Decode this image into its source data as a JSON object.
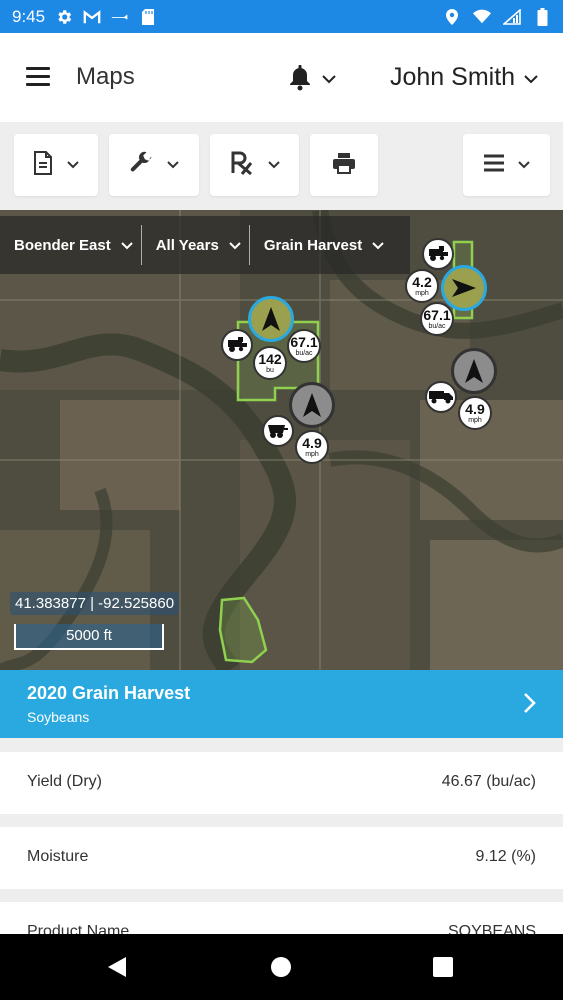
{
  "status_bar": {
    "time": "9:45"
  },
  "app_bar": {
    "title": "Maps",
    "user_name": "John Smith"
  },
  "map": {
    "filters": [
      {
        "label": "Boender East"
      },
      {
        "label": "All Years"
      },
      {
        "label": "Grain Harvest"
      }
    ],
    "coordinates": "41.383877 | -92.525860",
    "scale": "5000 ft",
    "bubbles": [
      {
        "value": "4.2",
        "unit": "mph"
      },
      {
        "value": "67.1",
        "unit": "bu/ac"
      },
      {
        "value": "142",
        "unit": "bu"
      },
      {
        "value": "67.1",
        "unit": "bu/ac"
      },
      {
        "value": "4.9",
        "unit": "mph"
      },
      {
        "value": "4.9",
        "unit": "mph"
      }
    ]
  },
  "harvest": {
    "title": "2020 Grain Harvest",
    "subtitle": "Soybeans"
  },
  "details": [
    {
      "label": "Yield (Dry)",
      "value": "46.67 (bu/ac)"
    },
    {
      "label": "Moisture",
      "value": "9.12 (%)"
    },
    {
      "label": "Product Name",
      "value": "SOYBEANS"
    }
  ],
  "colors": {
    "status_bar": "#1e88e5",
    "banner": "#29a9e0",
    "field_outline": "#8fd14f",
    "active_marker_ring": "#29a9e0"
  }
}
